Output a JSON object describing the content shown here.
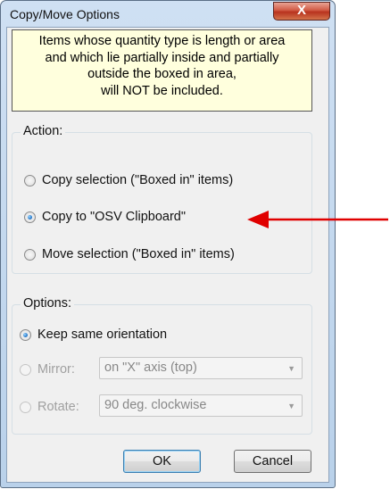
{
  "window": {
    "title": "Copy/Move Options",
    "close_icon": "close-icon",
    "close_glyph": "X"
  },
  "info": {
    "lines": [
      "Items whose quantity type is length or area",
      "and which lie partially inside and partially",
      "outside the boxed in area,",
      "will NOT be included."
    ]
  },
  "action": {
    "label": "Action:",
    "options": [
      {
        "label": "Copy selection (\"Boxed in\" items)",
        "selected": false
      },
      {
        "label": "Copy to \"OSV Clipboard\"",
        "selected": true
      },
      {
        "label": "Move selection (\"Boxed in\" items)",
        "selected": false
      }
    ]
  },
  "options": {
    "label": "Options:",
    "keep_orientation": {
      "label": "Keep same orientation",
      "selected": true
    },
    "mirror": {
      "label": "Mirror:",
      "selected": false,
      "enabled": false,
      "value": "on \"X\" axis (top)"
    },
    "rotate": {
      "label": "Rotate:",
      "selected": false,
      "enabled": false,
      "value": "90 deg. clockwise"
    }
  },
  "buttons": {
    "ok": "OK",
    "cancel": "Cancel"
  },
  "annotation": {
    "icon": "arrow-left-icon",
    "color": "#e00000"
  }
}
